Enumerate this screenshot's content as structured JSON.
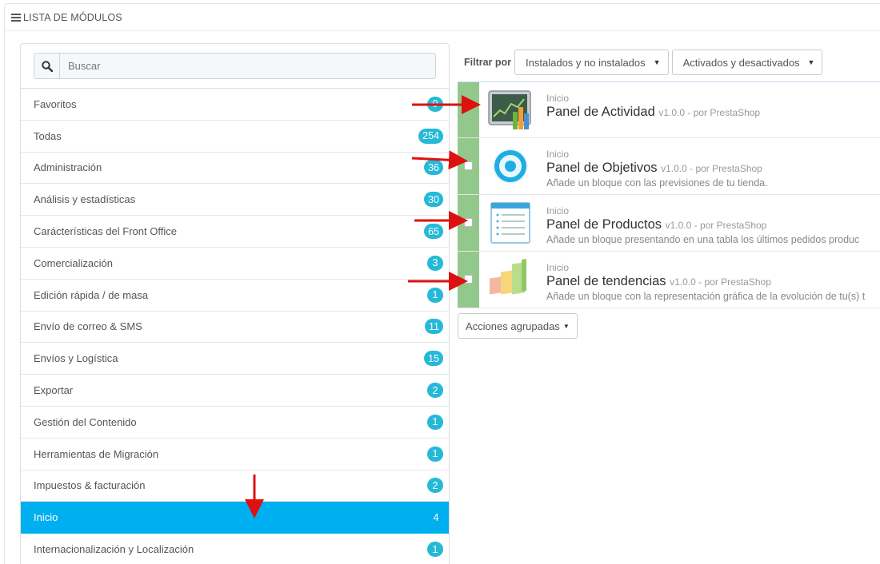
{
  "panel": {
    "title": "LISTA DE MÓDULOS"
  },
  "search": {
    "placeholder": "Buscar"
  },
  "categories": [
    {
      "label": "Favoritos",
      "count": "0"
    },
    {
      "label": "Todas",
      "count": "254"
    },
    {
      "label": "Administración",
      "count": "36"
    },
    {
      "label": "Análisis y estadísticas",
      "count": "30"
    },
    {
      "label": "Carácterísticas del Front Office",
      "count": "65"
    },
    {
      "label": "Comercialización",
      "count": "3"
    },
    {
      "label": "Edición rápida / de masa",
      "count": "1"
    },
    {
      "label": "Envío de correo & SMS",
      "count": "11"
    },
    {
      "label": "Envíos y Logística",
      "count": "15"
    },
    {
      "label": "Exportar",
      "count": "2"
    },
    {
      "label": "Gestión del Contenido",
      "count": "1"
    },
    {
      "label": "Herramientas de Migración",
      "count": "1"
    },
    {
      "label": "Impuestos & facturación",
      "count": "2"
    },
    {
      "label": "Inicio",
      "count": "4"
    },
    {
      "label": "Internacionalización y Localización",
      "count": "1"
    }
  ],
  "active_category": "Inicio",
  "filter": {
    "label": "Filtrar por",
    "install_select": "Instalados y no instalados",
    "status_select": "Activados y desactivados"
  },
  "modules": [
    {
      "category": "Inicio",
      "name": "Panel de Actividad",
      "meta": "v1.0.0 - por PrestaShop",
      "desc": "",
      "icon": "activity-chart-icon"
    },
    {
      "category": "Inicio",
      "name": "Panel de Objetivos",
      "meta": "v1.0.0 - por PrestaShop",
      "desc": "Añade un bloque con las previsiones de tu tienda.",
      "icon": "target-icon"
    },
    {
      "category": "Inicio",
      "name": "Panel de Productos",
      "meta": "v1.0.0 - por PrestaShop",
      "desc": "Añade un bloque presentando en una tabla los últimos pedidos produc",
      "icon": "list-document-icon"
    },
    {
      "category": "Inicio",
      "name": "Panel de tendencias",
      "meta": "v1.0.0 - por PrestaShop",
      "desc": "Añade un bloque con la representación gráfica de la evolución de tu(s) t",
      "icon": "trend-bars-icon"
    }
  ],
  "bulk_actions": {
    "label": "Acciones agrupadas"
  },
  "colors": {
    "accent": "#00aff0",
    "badge": "#25b9d7",
    "module_strip": "#93c88c",
    "annotation_arrow": "#dd1111"
  }
}
